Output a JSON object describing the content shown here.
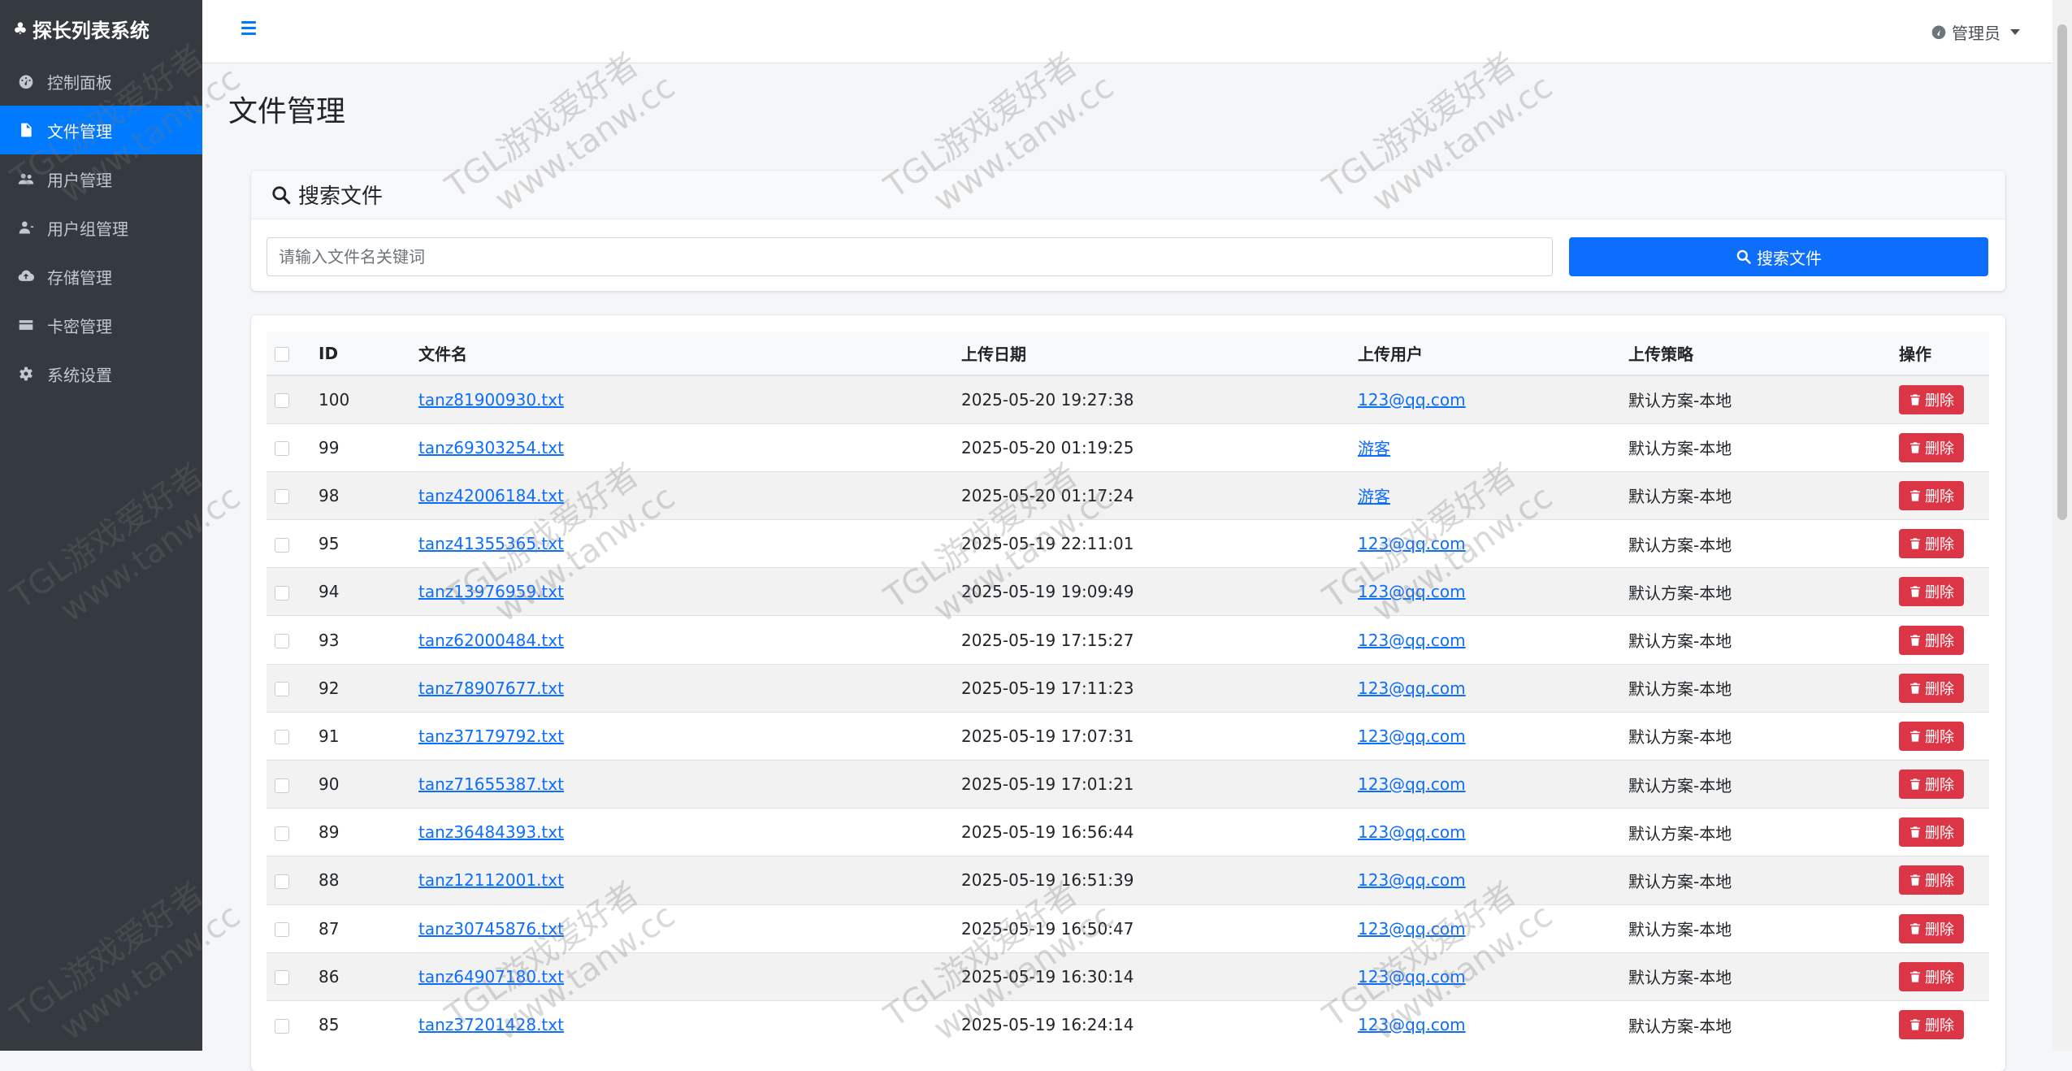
{
  "brand": {
    "title": "探长列表系统"
  },
  "sidebar": {
    "items": [
      {
        "label": "控制面板",
        "icon": "dashboard-icon",
        "active": false
      },
      {
        "label": "文件管理",
        "icon": "file-icon",
        "active": true
      },
      {
        "label": "用户管理",
        "icon": "users-icon",
        "active": false
      },
      {
        "label": "用户组管理",
        "icon": "user-group-icon",
        "active": false
      },
      {
        "label": "存储管理",
        "icon": "cloud-upload-icon",
        "active": false
      },
      {
        "label": "卡密管理",
        "icon": "credit-card-icon",
        "active": false
      },
      {
        "label": "系统设置",
        "icon": "gear-icon",
        "active": false
      }
    ]
  },
  "header": {
    "user_label": "管理员"
  },
  "page": {
    "title": "文件管理"
  },
  "search": {
    "card_title": "搜索文件",
    "placeholder": "请输入文件名关键词",
    "button_label": "搜索文件"
  },
  "table": {
    "columns": [
      "ID",
      "文件名",
      "上传日期",
      "上传用户",
      "上传策略",
      "操作"
    ],
    "delete_label": "删除",
    "rows": [
      {
        "id": "100",
        "filename": "tanz81900930.txt",
        "date": "2025-05-20 19:27:38",
        "user": "123@qq.com",
        "policy": "默认方案-本地"
      },
      {
        "id": "99",
        "filename": "tanz69303254.txt",
        "date": "2025-05-20 01:19:25",
        "user": "游客",
        "policy": "默认方案-本地"
      },
      {
        "id": "98",
        "filename": "tanz42006184.txt",
        "date": "2025-05-20 01:17:24",
        "user": "游客",
        "policy": "默认方案-本地"
      },
      {
        "id": "95",
        "filename": "tanz41355365.txt",
        "date": "2025-05-19 22:11:01",
        "user": "123@qq.com",
        "policy": "默认方案-本地"
      },
      {
        "id": "94",
        "filename": "tanz13976959.txt",
        "date": "2025-05-19 19:09:49",
        "user": "123@qq.com",
        "policy": "默认方案-本地"
      },
      {
        "id": "93",
        "filename": "tanz62000484.txt",
        "date": "2025-05-19 17:15:27",
        "user": "123@qq.com",
        "policy": "默认方案-本地"
      },
      {
        "id": "92",
        "filename": "tanz78907677.txt",
        "date": "2025-05-19 17:11:23",
        "user": "123@qq.com",
        "policy": "默认方案-本地"
      },
      {
        "id": "91",
        "filename": "tanz37179792.txt",
        "date": "2025-05-19 17:07:31",
        "user": "123@qq.com",
        "policy": "默认方案-本地"
      },
      {
        "id": "90",
        "filename": "tanz71655387.txt",
        "date": "2025-05-19 17:01:21",
        "user": "123@qq.com",
        "policy": "默认方案-本地"
      },
      {
        "id": "89",
        "filename": "tanz36484393.txt",
        "date": "2025-05-19 16:56:44",
        "user": "123@qq.com",
        "policy": "默认方案-本地"
      },
      {
        "id": "88",
        "filename": "tanz12112001.txt",
        "date": "2025-05-19 16:51:39",
        "user": "123@qq.com",
        "policy": "默认方案-本地"
      },
      {
        "id": "87",
        "filename": "tanz30745876.txt",
        "date": "2025-05-19 16:50:47",
        "user": "123@qq.com",
        "policy": "默认方案-本地"
      },
      {
        "id": "86",
        "filename": "tanz64907180.txt",
        "date": "2025-05-19 16:30:14",
        "user": "123@qq.com",
        "policy": "默认方案-本地"
      },
      {
        "id": "85",
        "filename": "tanz37201428.txt",
        "date": "2025-05-19 16:24:14",
        "user": "123@qq.com",
        "policy": "默认方案-本地"
      }
    ]
  },
  "watermark": {
    "line1": "TGL游戏爱好者",
    "line2": "www.tanw.cc"
  },
  "colors": {
    "sidebar_bg": "#343a40",
    "accent": "#007bff",
    "danger": "#dc3545"
  }
}
